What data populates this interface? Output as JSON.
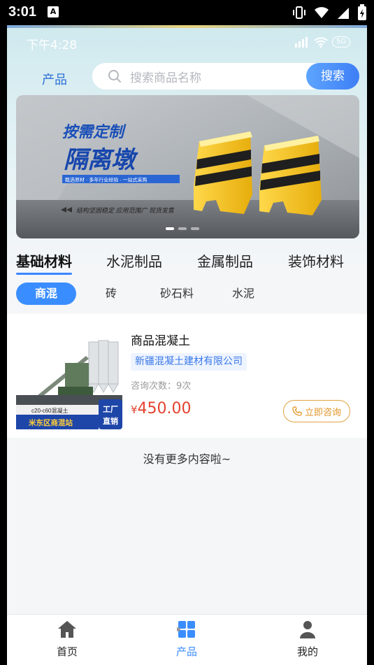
{
  "device_status": {
    "time": "3:01",
    "notification_badge": "A"
  },
  "inner_status": {
    "time": "下午4:28",
    "network": "5G"
  },
  "header": {
    "title": "产品",
    "search_placeholder": "搜索商品名称",
    "search_button": "搜索"
  },
  "banner": {
    "headline_1": "按需定制",
    "headline_2": "隔离墩",
    "tagline": "甄选原材 · 多年行业经验 · 一站式采购",
    "footer_text": "结构坚固稳定  应用范围广  现货发售",
    "active_slide": 1,
    "slide_count": 3
  },
  "categories": [
    {
      "label": "基础材料",
      "active": true
    },
    {
      "label": "水泥制品",
      "active": false
    },
    {
      "label": "金属制品",
      "active": false
    },
    {
      "label": "装饰材料",
      "active": false
    }
  ],
  "subcategories": [
    {
      "label": "商混",
      "active": true
    },
    {
      "label": "砖",
      "active": false
    },
    {
      "label": "砂石料",
      "active": false
    },
    {
      "label": "水泥",
      "active": false
    }
  ],
  "product": {
    "name": "商品混凝土",
    "company": "新疆混凝土建材有限公司",
    "consult_count": "咨询次数：9次",
    "price_symbol": "¥",
    "price": "450.00",
    "consult_button": "立即咨询",
    "image_tag_spec": "c20-c60混凝土",
    "image_tag_station": "米东区商混站",
    "image_tag_factory_1": "工厂",
    "image_tag_factory_2": "直销"
  },
  "no_more_text": "没有更多内容啦~",
  "tabbar": [
    {
      "label": "首页",
      "icon": "home-icon",
      "active": false
    },
    {
      "label": "产品",
      "icon": "grid-icon",
      "active": true
    },
    {
      "label": "我的",
      "icon": "user-icon",
      "active": false
    }
  ],
  "colors": {
    "accent": "#3a8dff",
    "price": "#e3432f",
    "consult": "#e0962a",
    "banner_yellow": "#f5c518"
  }
}
